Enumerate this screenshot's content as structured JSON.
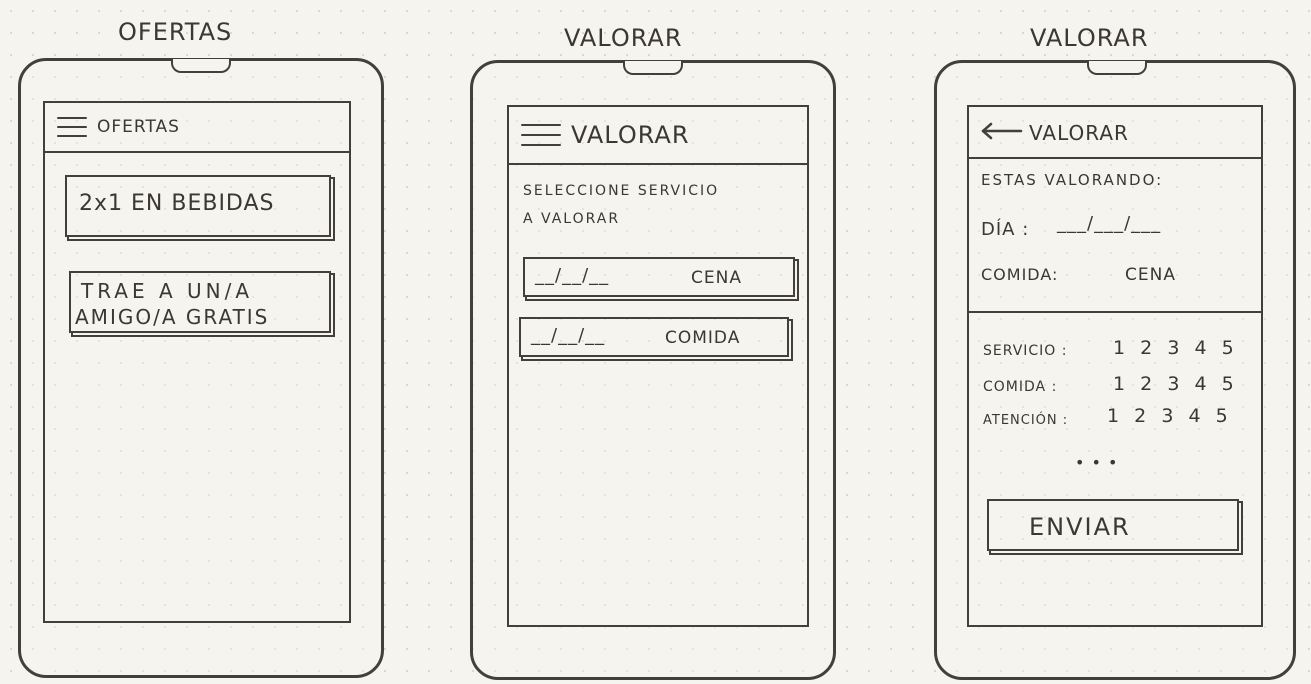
{
  "screens": {
    "ofertas": {
      "caption": "OFERTAS",
      "appbar_title": "OFERTAS",
      "offers": [
        "2x1 EN BEBIDAS",
        "TRAE A UN/A",
        "AMIGO/A GRATIS"
      ]
    },
    "valorar_list": {
      "caption": "VALORAR",
      "appbar_title": "VALORAR",
      "instruction_line1": "SELECCIONE SERVICIO",
      "instruction_line2": "A VALORAR",
      "services": [
        {
          "date": "__/__/__",
          "label": "CENA"
        },
        {
          "date": "__/__/__",
          "label": "COMIDA"
        }
      ]
    },
    "valorar_detail": {
      "caption": "VALORAR",
      "appbar_title": "VALORAR",
      "heading": "ESTAS VALORANDO:",
      "day_label": "DÍA :",
      "day_value": "___/___/___",
      "meal_label": "COMIDA:",
      "meal_value": "CENA",
      "ratings": [
        {
          "label": "SERVICIO :",
          "scale": "1  2  3  4  5"
        },
        {
          "label": "COMIDA :",
          "scale": "1  2  3  4  5"
        },
        {
          "label": "ATENCIÓN :",
          "scale": "1  2  3  4  5"
        }
      ],
      "more": "• • •",
      "submit_label": "ENVIAR"
    }
  }
}
